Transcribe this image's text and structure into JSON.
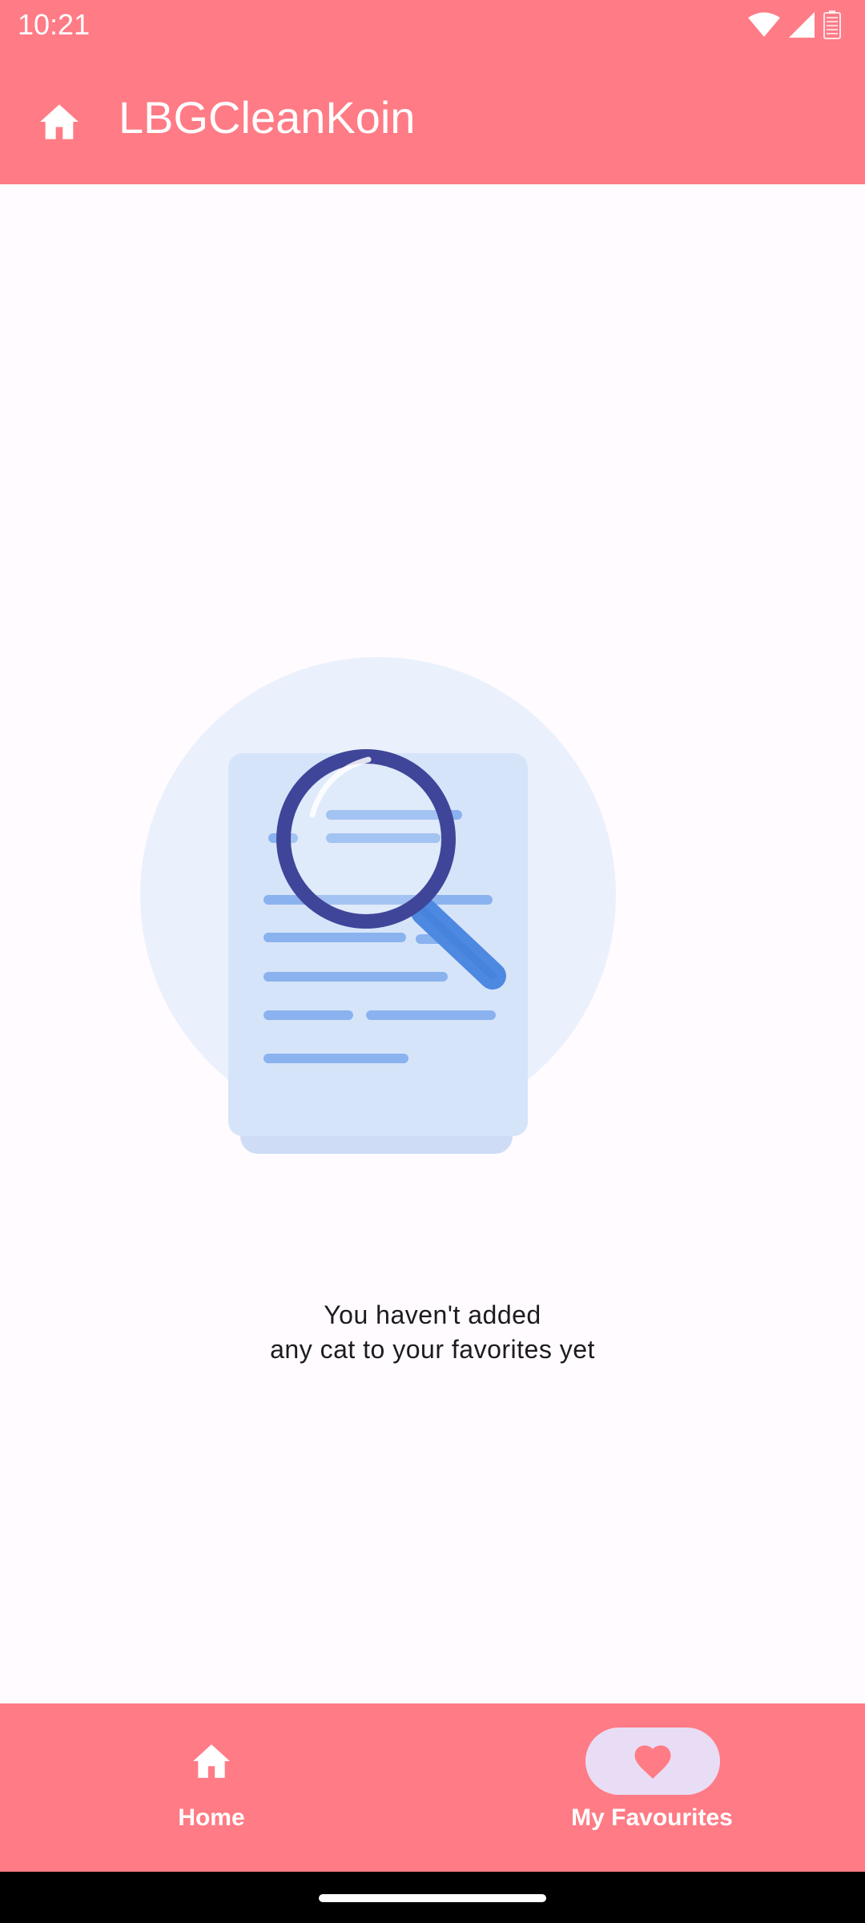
{
  "status_bar": {
    "time": "10:21",
    "icons": [
      "wifi-icon",
      "cellular-signal-icon",
      "battery-icon"
    ]
  },
  "app_bar": {
    "title": "LBGCleanKoin",
    "leading_icon": "home-icon"
  },
  "empty_state": {
    "illustration": "document-magnifier-illustration",
    "message": "You haven't added\nany cat to your favorites yet"
  },
  "bottom_nav": {
    "items": [
      {
        "label": "Home",
        "icon": "home-icon",
        "selected": false
      },
      {
        "label": "My Favourites",
        "icon": "heart-icon",
        "selected": true
      }
    ]
  },
  "colors": {
    "primary": "#ff7b85",
    "background": "#fffbfe",
    "selected_pill": "#e9ddf6",
    "heart": "#ff7b85"
  }
}
